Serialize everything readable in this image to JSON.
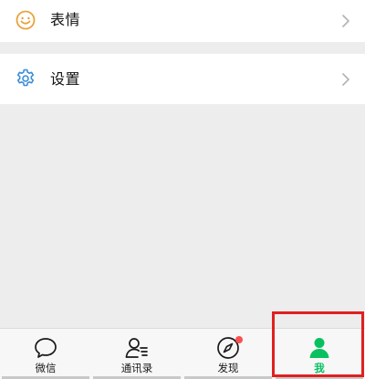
{
  "menu": {
    "emoji": {
      "label": "表情",
      "icon": "smiley-icon"
    },
    "settings": {
      "label": "设置",
      "icon": "gear-icon"
    }
  },
  "tabbar": {
    "tabs": [
      {
        "label": "微信",
        "icon": "chat-bubble-icon",
        "active": false
      },
      {
        "label": "通讯录",
        "icon": "contacts-icon",
        "active": false
      },
      {
        "label": "发现",
        "icon": "compass-icon",
        "active": false,
        "badge": true
      },
      {
        "label": "我",
        "icon": "person-icon",
        "active": true
      }
    ]
  },
  "colors": {
    "accent": "#07c160",
    "badge": "#fa5151",
    "highlight": "#e02020",
    "emoji_icon": "#e9a23b",
    "settings_icon": "#3c8ed8"
  }
}
